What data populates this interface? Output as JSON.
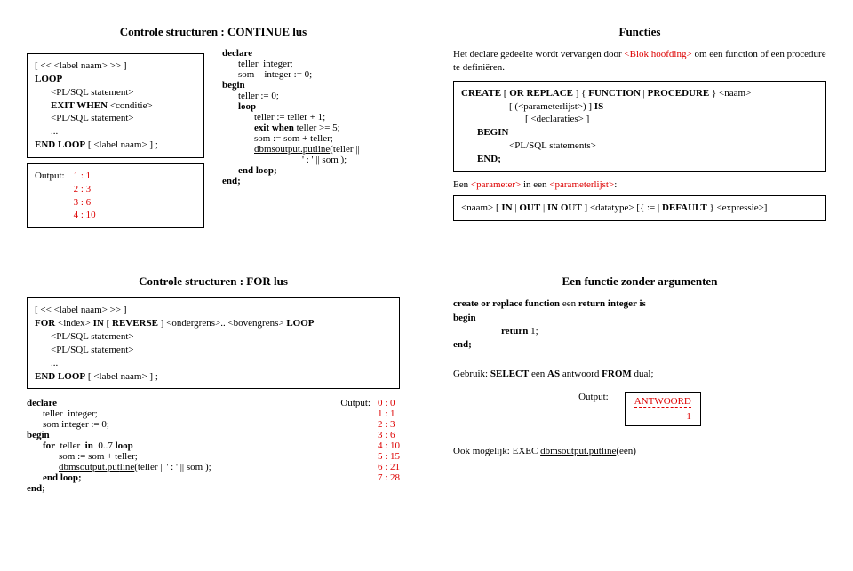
{
  "q1": {
    "title": "Controle structuren : CONTINUE lus",
    "syntax": {
      "l1": "[ << <label naam> >> ]",
      "l2": "LOOP",
      "l3": "<PL/SQL statement>",
      "l4a": "EXIT WHEN",
      "l4b": " <conditie>",
      "l5": "<PL/SQL statement>",
      "l6": "...",
      "l7a": "END LOOP",
      "l7b": " [ <label naam> ] ;"
    },
    "out_label": "Output:",
    "out": [
      "1 : 1",
      "2 : 3",
      "3 : 6",
      "4 : 10"
    ],
    "code": {
      "l1": "declare",
      "l2a": "teller",
      "l2b": "  integer;",
      "l3a": "som",
      "l3b": "    integer := 0;",
      "l4": "begin",
      "l5": "teller := 0;",
      "l6": "loop",
      "l7": "teller := teller + 1;",
      "l8a": "exit when",
      "l8b": " teller >= 5;",
      "l9": "som := som + teller;",
      "l10": "dbms_output.put_line(teller ||",
      "l11": "' : ' || som );",
      "l12": "end loop;",
      "l13": "end;"
    }
  },
  "q2": {
    "title": "Functies",
    "intro1": "Het declare gedeelte wordt vervangen door ",
    "intro2": "<Blok hoofding>",
    "intro3": "  om een function of een procedure te definiëren.",
    "syntax": {
      "l1a": "CREATE",
      "l1b": " [ ",
      "l1c": "OR REPLACE",
      "l1d": " ] { ",
      "l1e": "FUNCTION",
      "l1f": " | ",
      "l1g": "PROCEDURE",
      "l1h": " } <naam>",
      "l2a": "[ (<parameterlijst>) ] ",
      "l2b": "IS",
      "l3": "[ <declaraties> ]",
      "l4": "BEGIN",
      "l5": "<PL/SQL statements>",
      "l6": "END;"
    },
    "param_intro1": "Een ",
    "param_intro2": "<parameter>",
    "param_intro3": " in een ",
    "param_intro4": "<parameterlijst>",
    "param_intro5": ":",
    "p2a": "<naam> [ ",
    "p2b": "IN",
    "p2c": " | ",
    "p2d": "OUT",
    "p2e": " | ",
    "p2f": "IN OUT",
    "p2g": " ] <datatype> [{ := | ",
    "p2h": "DEFAULT",
    "p2i": " } <expressie>]"
  },
  "q3": {
    "title": "Controle structuren : FOR lus",
    "syntax": {
      "l1": "[ << <label naam> >> ]",
      "l2a": "FOR",
      "l2b": " <index> ",
      "l2c": "IN",
      "l2d": " [ ",
      "l2e": "REVERSE",
      "l2f": " ] <ondergrens>.. <bovengrens> ",
      "l2g": "LOOP",
      "l3": "<PL/SQL statement>",
      "l4": "<PL/SQL statement>",
      "l5": "...",
      "l6a": "END LOOP",
      "l6b": " [ <label naam> ] ;"
    },
    "code": {
      "l1": "declare",
      "l2": "teller  integer;",
      "l3": "som integer := 0;",
      "l4": "begin",
      "l5a": "for",
      "l5b": "  teller  ",
      "l5c": "in",
      "l5d": "  0..7 ",
      "l5e": "loop",
      "l6": "som := som + teller;",
      "l7": "dbms_output.put_line(teller || ' : ' || som );",
      "l8": "end loop;",
      "l9": "end;"
    },
    "out_label": "Output:",
    "out": [
      "0 : 0",
      "1 : 1",
      "2 : 3",
      "3 : 6",
      "4 : 10",
      "5 : 15",
      "6 : 21",
      "7 : 28"
    ]
  },
  "q4": {
    "title": "Een functie zonder argumenten",
    "code": {
      "l1a": "create or replace function",
      "l1b": " een ",
      "l1c": "return integer is",
      "l2": "begin",
      "l3a": "return",
      "l3b": " 1;",
      "l4": "end;"
    },
    "use1a": "Gebruik: ",
    "use1b": "SELECT",
    "use1c": " een ",
    "use1d": "AS",
    "use1e": " antwoord ",
    "use1f": "FROM",
    "use1g": " dual;",
    "out_label": "Output:",
    "out_head": "ANTWOORD",
    "out_val": "1",
    "also": "Ook mogelijk: EXEC dbms_output.put_line(een)"
  }
}
